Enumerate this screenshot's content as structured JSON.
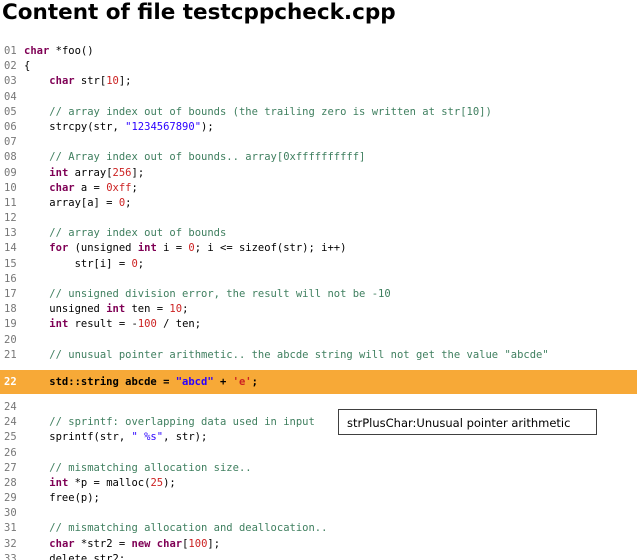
{
  "title": "Content of file testcppcheck.cpp",
  "highlight_line": "22",
  "tooltip": "strPlusChar:Unusual pointer arithmetic",
  "colors": {
    "highlight": "#f7a937",
    "keyword": "#7f0055",
    "string": "#2a00ff",
    "number": "#cc2222",
    "comment": "#3f7f5f",
    "line_number": "#777777"
  },
  "lines": [
    {
      "n": "01",
      "tokens": [
        [
          "kw",
          "char"
        ],
        [
          "plain",
          " *foo()"
        ]
      ]
    },
    {
      "n": "02",
      "tokens": [
        [
          "plain",
          "{"
        ]
      ]
    },
    {
      "n": "03",
      "tokens": [
        [
          "plain",
          "    "
        ],
        [
          "kw",
          "char"
        ],
        [
          "plain",
          " str["
        ],
        [
          "num",
          "10"
        ],
        [
          "plain",
          "];"
        ]
      ]
    },
    {
      "n": "04",
      "tokens": []
    },
    {
      "n": "05",
      "tokens": [
        [
          "plain",
          "    "
        ],
        [
          "cmt",
          "// array index out of bounds (the trailing zero is written at str[10])"
        ]
      ]
    },
    {
      "n": "06",
      "tokens": [
        [
          "plain",
          "    strcpy(str, "
        ],
        [
          "str",
          "\"1234567890\""
        ],
        [
          "plain",
          ");"
        ]
      ]
    },
    {
      "n": "07",
      "tokens": []
    },
    {
      "n": "08",
      "tokens": [
        [
          "plain",
          "    "
        ],
        [
          "cmt",
          "// Array index out of bounds.. array[0xffffffffff]"
        ]
      ]
    },
    {
      "n": "09",
      "tokens": [
        [
          "plain",
          "    "
        ],
        [
          "kw",
          "int"
        ],
        [
          "plain",
          " array["
        ],
        [
          "num",
          "256"
        ],
        [
          "plain",
          "];"
        ]
      ]
    },
    {
      "n": "10",
      "tokens": [
        [
          "plain",
          "    "
        ],
        [
          "kw",
          "char"
        ],
        [
          "plain",
          " a = "
        ],
        [
          "num",
          "0xff"
        ],
        [
          "plain",
          ";"
        ]
      ]
    },
    {
      "n": "11",
      "tokens": [
        [
          "plain",
          "    array[a] = "
        ],
        [
          "num",
          "0"
        ],
        [
          "plain",
          ";"
        ]
      ]
    },
    {
      "n": "12",
      "tokens": []
    },
    {
      "n": "13",
      "tokens": [
        [
          "plain",
          "    "
        ],
        [
          "cmt",
          "// array index out of bounds"
        ]
      ]
    },
    {
      "n": "14",
      "tokens": [
        [
          "plain",
          "    "
        ],
        [
          "kw",
          "for"
        ],
        [
          "plain",
          " (unsigned "
        ],
        [
          "kw",
          "int"
        ],
        [
          "plain",
          " i = "
        ],
        [
          "num",
          "0"
        ],
        [
          "plain",
          "; i <= sizeof(str); i++)"
        ]
      ]
    },
    {
      "n": "15",
      "tokens": [
        [
          "plain",
          "        str[i] = "
        ],
        [
          "num",
          "0"
        ],
        [
          "plain",
          ";"
        ]
      ]
    },
    {
      "n": "16",
      "tokens": []
    },
    {
      "n": "17",
      "tokens": [
        [
          "plain",
          "    "
        ],
        [
          "cmt",
          "// unsigned division error, the result will not be -10"
        ]
      ]
    },
    {
      "n": "18",
      "tokens": [
        [
          "plain",
          "    unsigned "
        ],
        [
          "kw",
          "int"
        ],
        [
          "plain",
          " ten = "
        ],
        [
          "num",
          "10"
        ],
        [
          "plain",
          ";"
        ]
      ]
    },
    {
      "n": "19",
      "tokens": [
        [
          "plain",
          "    "
        ],
        [
          "kw",
          "int"
        ],
        [
          "plain",
          " result = -"
        ],
        [
          "num",
          "100"
        ],
        [
          "plain",
          " / ten;"
        ]
      ]
    },
    {
      "n": "20",
      "tokens": []
    },
    {
      "n": "21",
      "tokens": [
        [
          "plain",
          "    "
        ],
        [
          "cmt",
          "// unusual pointer arithmetic.. the abcde string will not get the value \"abcde\""
        ]
      ]
    },
    {
      "n": "22",
      "tokens": [
        [
          "plain",
          "    std::string abcde = "
        ],
        [
          "str",
          "\"abcd\""
        ],
        [
          "plain",
          " + "
        ],
        [
          "num",
          "'e'"
        ],
        [
          "plain",
          ";"
        ]
      ]
    },
    {
      "n": "24",
      "tokens": []
    },
    {
      "n": "24",
      "tokens": [
        [
          "plain",
          "    "
        ],
        [
          "cmt",
          "// sprintf: overlapping data used in input"
        ]
      ]
    },
    {
      "n": "25",
      "tokens": [
        [
          "plain",
          "    sprintf(str, "
        ],
        [
          "str",
          "\" %s\""
        ],
        [
          "plain",
          ", str);"
        ]
      ]
    },
    {
      "n": "26",
      "tokens": []
    },
    {
      "n": "27",
      "tokens": [
        [
          "plain",
          "    "
        ],
        [
          "cmt",
          "// mismatching allocation size.."
        ]
      ]
    },
    {
      "n": "28",
      "tokens": [
        [
          "plain",
          "    "
        ],
        [
          "kw",
          "int"
        ],
        [
          "plain",
          " *p = malloc("
        ],
        [
          "num",
          "25"
        ],
        [
          "plain",
          ");"
        ]
      ]
    },
    {
      "n": "29",
      "tokens": [
        [
          "plain",
          "    free(p);"
        ]
      ]
    },
    {
      "n": "30",
      "tokens": []
    },
    {
      "n": "31",
      "tokens": [
        [
          "plain",
          "    "
        ],
        [
          "cmt",
          "// mismatching allocation and deallocation.."
        ]
      ]
    },
    {
      "n": "32",
      "tokens": [
        [
          "plain",
          "    "
        ],
        [
          "kw",
          "char"
        ],
        [
          "plain",
          " *str2 = "
        ],
        [
          "kw",
          "new"
        ],
        [
          "plain",
          " "
        ],
        [
          "kw",
          "char"
        ],
        [
          "plain",
          "["
        ],
        [
          "num",
          "100"
        ],
        [
          "plain",
          "];"
        ]
      ]
    },
    {
      "n": "33",
      "tokens": [
        [
          "plain",
          "    delete str2;"
        ]
      ]
    }
  ]
}
